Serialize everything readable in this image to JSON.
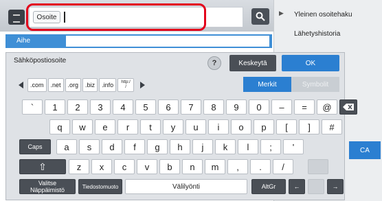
{
  "header": {
    "address_label": "Osoite",
    "address_value": ""
  },
  "background": {
    "subject_label": "Aihe",
    "right_panel": [
      "Yleinen osoitehaku",
      "Lähetyshistoria"
    ],
    "ca_button": "CA"
  },
  "keyboard": {
    "field_label": "Sähköpostiosoite",
    "help": "?",
    "cancel": "Keskeytä",
    "ok": "OK",
    "domains": [
      ".com",
      ".net",
      ".org",
      ".biz",
      ".info",
      "http:/",
      "/"
    ],
    "toggle_chars": "Merkit",
    "toggle_symbols": "Symbolit",
    "row1": [
      "`",
      "1",
      "2",
      "3",
      "4",
      "5",
      "6",
      "7",
      "8",
      "9",
      "0",
      "–",
      "=",
      "@"
    ],
    "row2": [
      "q",
      "w",
      "e",
      "r",
      "t",
      "y",
      "u",
      "i",
      "o",
      "p",
      "[",
      "]",
      "#"
    ],
    "caps": "Caps",
    "row3": [
      "a",
      "s",
      "d",
      "f",
      "g",
      "h",
      "j",
      "k",
      "l",
      ";",
      "'"
    ],
    "shift": "⇧",
    "row4": [
      "z",
      "x",
      "c",
      "v",
      "b",
      "n",
      "m",
      ",",
      ".",
      "/"
    ],
    "layout_key": [
      "Valitse",
      "Näppäimistö"
    ],
    "filename_key": "Tiedostomuoto",
    "space": "Välilyönti",
    "altgr": "AltGr",
    "left_arrow": "←",
    "right_arrow": "→"
  }
}
